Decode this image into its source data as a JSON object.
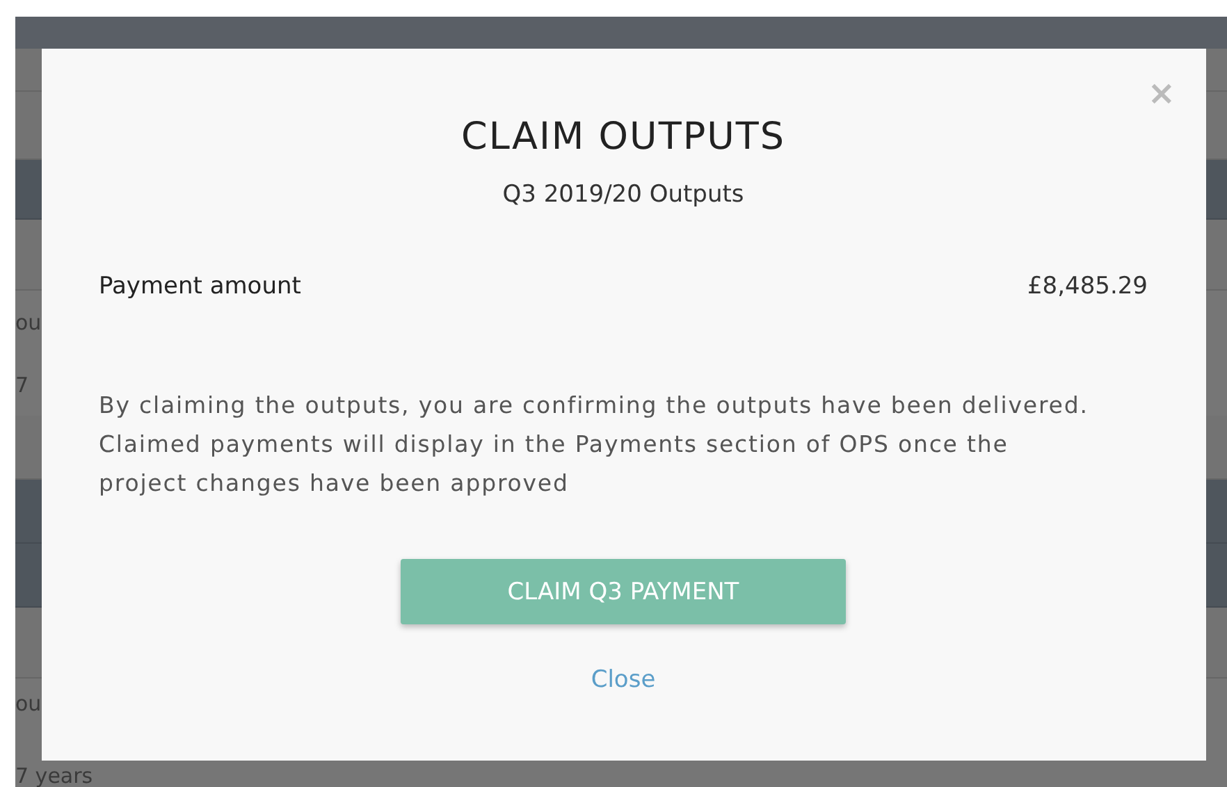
{
  "background": {
    "fragments": [
      {
        "text": "ou"
      },
      {
        "text": "7"
      },
      {
        "text": "ou"
      },
      {
        "text": "7 years"
      }
    ]
  },
  "modal": {
    "title": "CLAIM OUTPUTS",
    "subtitle": "Q3 2019/20 Outputs",
    "close_icon": "×",
    "payment": {
      "label": "Payment amount",
      "value": "£8,485.29"
    },
    "message": "By claiming the outputs, you are confirming the outputs have been delivered. Claimed payments will display in the Payments section of OPS once the project changes have been approved",
    "primary_button": "CLAIM Q3 PAYMENT",
    "close_link": "Close"
  }
}
